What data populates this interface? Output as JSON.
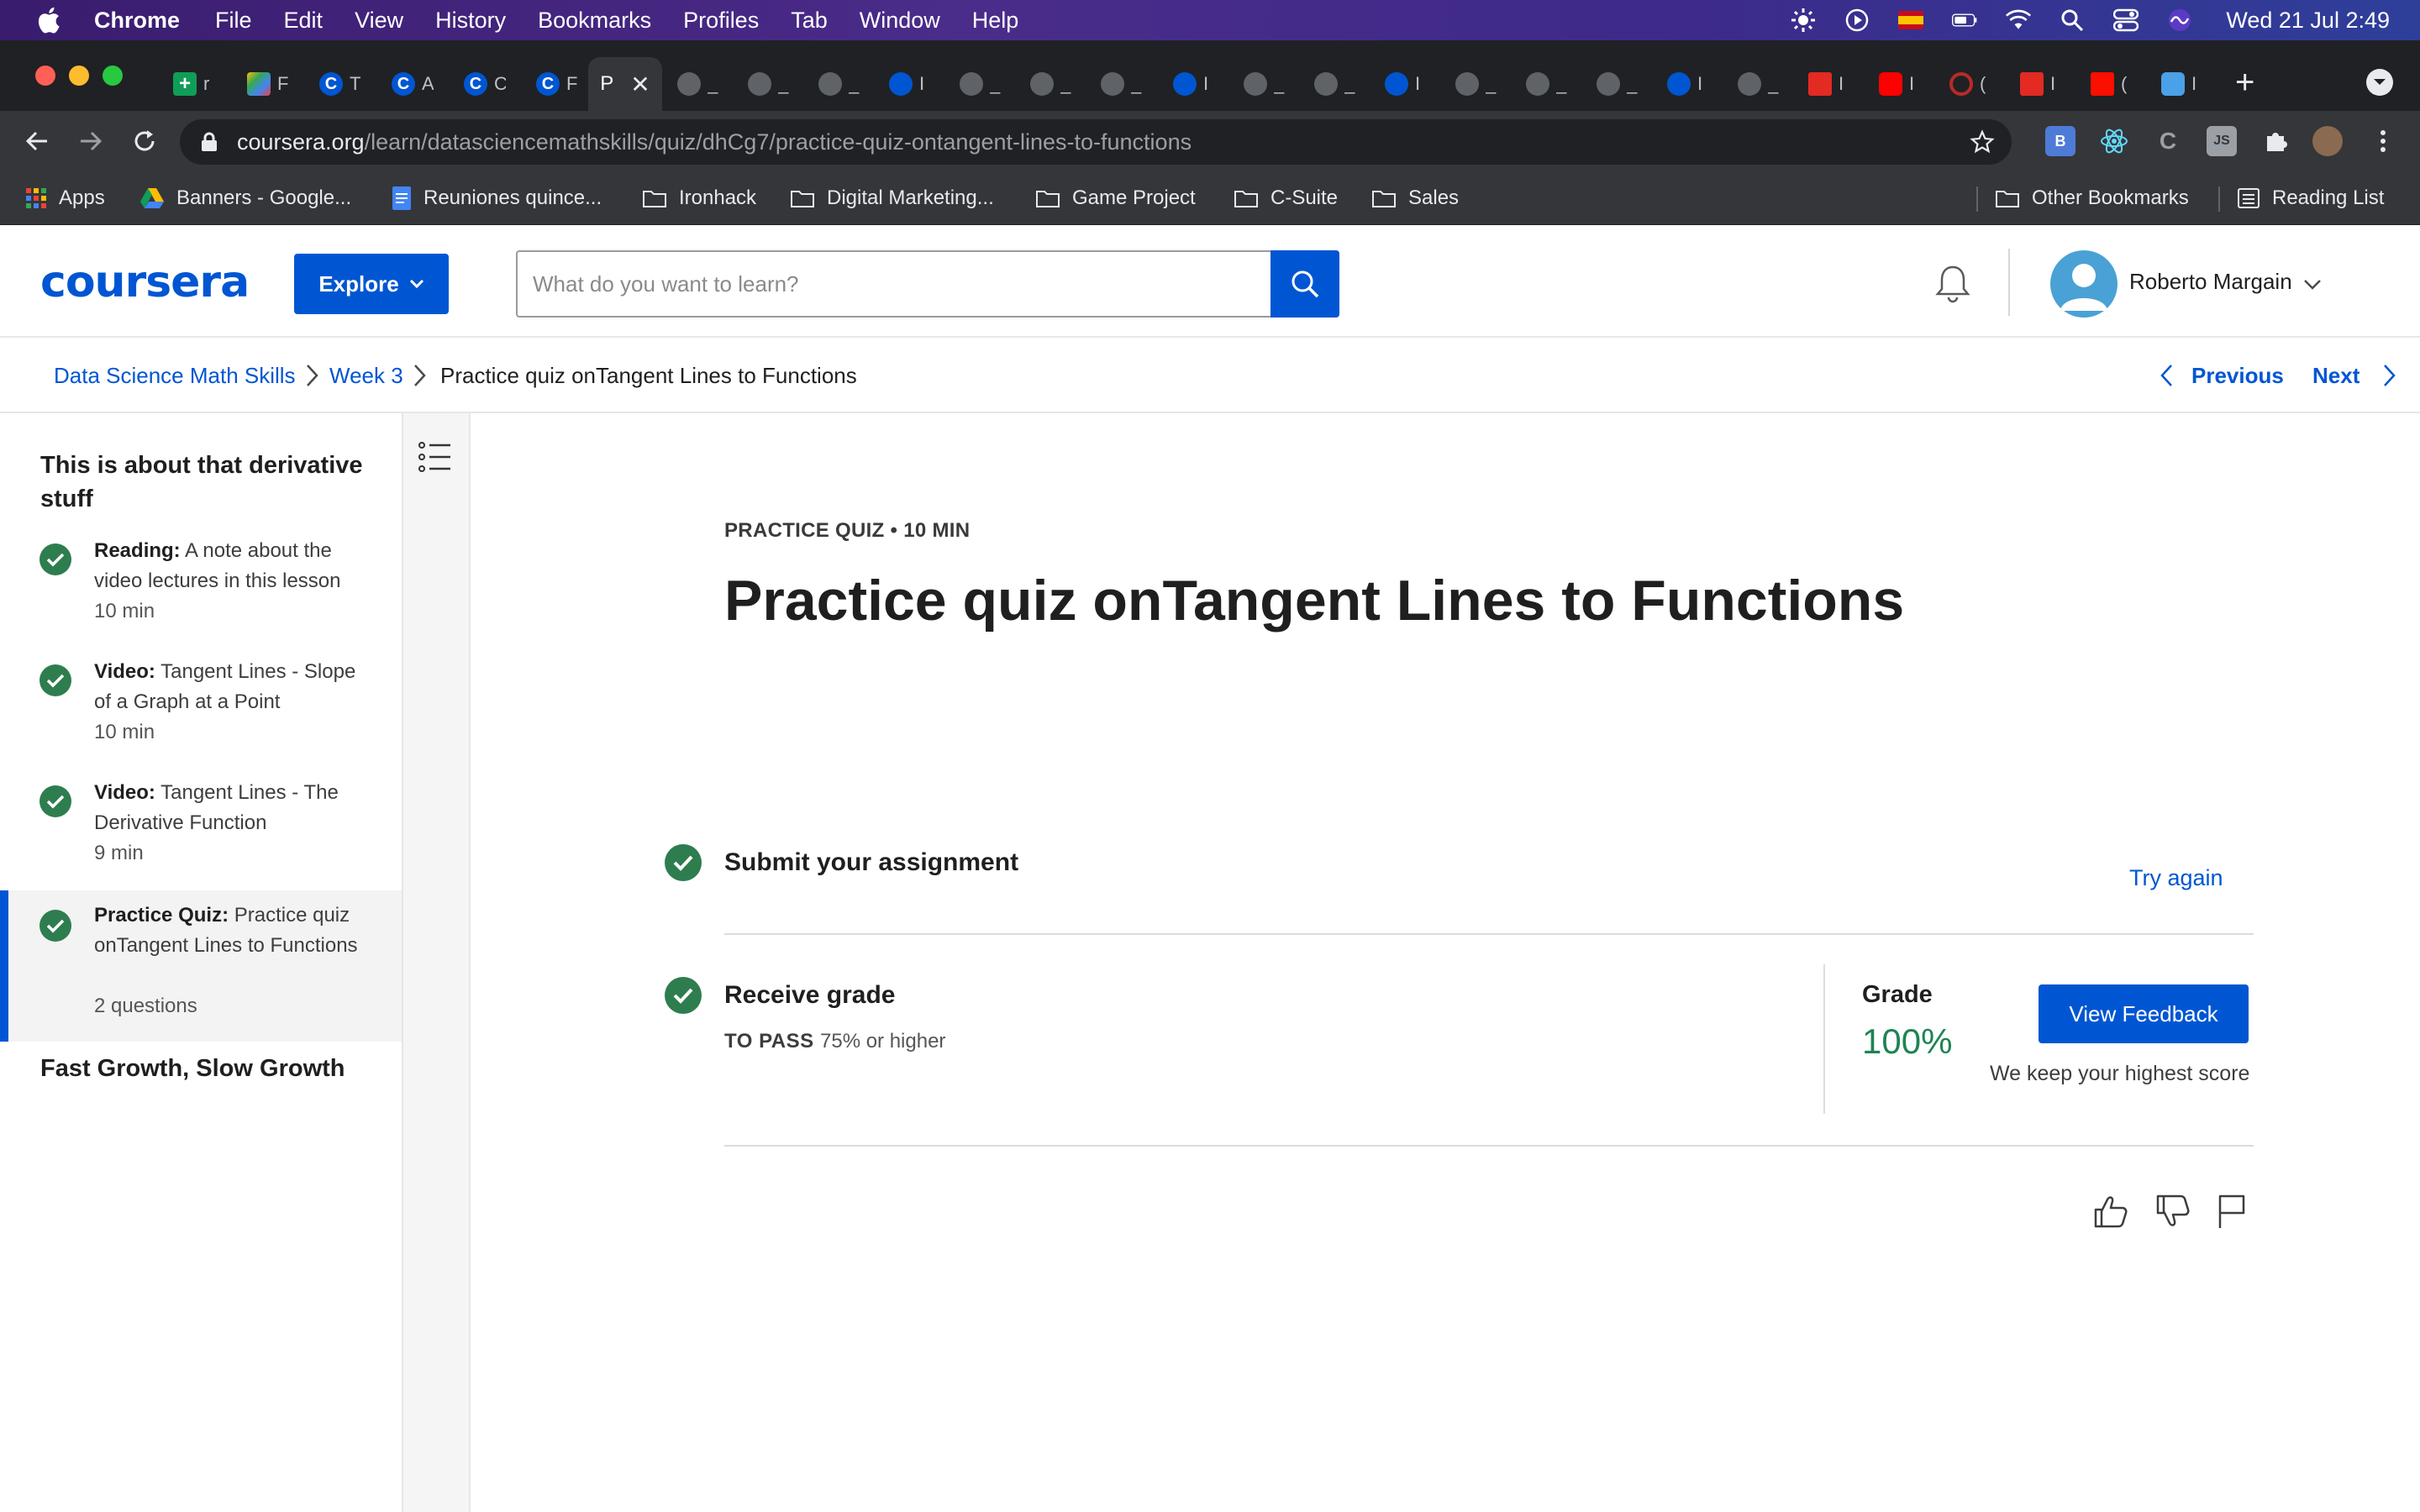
{
  "menubar": {
    "app": "Chrome",
    "items": [
      "File",
      "Edit",
      "View",
      "History",
      "Bookmarks",
      "Profiles",
      "Tab",
      "Window",
      "Help"
    ],
    "clock": "Wed 21 Jul  2:49"
  },
  "tabs": {
    "active_title": "P",
    "favicons": [
      "sheets-icon",
      "colorful-icon",
      "coursera-icon",
      "coursera-icon",
      "coursera-icon",
      "coursera-icon",
      "page-icon",
      "globe-icon",
      "globe-icon",
      "globe-icon",
      "coursera-icon",
      "globe-icon",
      "globe-icon",
      "globe-icon",
      "coursera-icon",
      "globe-icon",
      "globe-icon",
      "coursera-icon",
      "globe-icon",
      "globe-icon",
      "globe-icon",
      "coursera-icon",
      "globe-icon",
      "red-n-icon",
      "youtube-icon",
      "red-q-icon",
      "red-n-icon",
      "adobe-icon",
      "blue-icon"
    ],
    "snippets": [
      "r",
      "F",
      "T",
      "A",
      "C",
      "F",
      "",
      "_",
      "_",
      "_",
      "I",
      "_",
      "_",
      "_",
      "I",
      "_",
      "_",
      "I",
      "_",
      "_",
      "_",
      "I",
      "_",
      "I",
      "I",
      "(",
      "I",
      "(",
      "I"
    ]
  },
  "toolbar": {
    "url_host": "coursera.org",
    "url_path": "/learn/datasciencemathskills/quiz/dhCg7/practice-quiz-ontangent-lines-to-functions"
  },
  "bookmarks": {
    "items": [
      "Apps",
      "Banners - Google...",
      "Reuniones quince...",
      "Ironhack",
      "Digital Marketing...",
      "Game Project",
      "C-Suite",
      "Sales"
    ],
    "right": [
      "Other Bookmarks",
      "Reading List"
    ]
  },
  "header": {
    "logo": "coursera",
    "explore": "Explore",
    "search_placeholder": "What do you want to learn?",
    "user_name": "Roberto Margain"
  },
  "breadcrumb": {
    "items": [
      "Data Science Math Skills",
      "Week 3",
      "Practice quiz onTangent Lines to Functions"
    ],
    "previous": "Previous",
    "next": "Next"
  },
  "sidebar": {
    "module_title": "This is about that derivative stuff",
    "items": [
      {
        "type": "Reading:",
        "title": "A note about the video lectures in this lesson",
        "duration": "10 min"
      },
      {
        "type": "Video:",
        "title": "Tangent Lines - Slope of a Graph at a Point",
        "duration": "10 min"
      },
      {
        "type": "Video:",
        "title": "Tangent Lines - The Derivative Function",
        "duration": "9 min"
      },
      {
        "type": "Practice Quiz:",
        "title": "Practice quiz onTangent Lines to Functions",
        "duration": "2 questions"
      }
    ],
    "next_module": "Fast Growth, Slow Growth"
  },
  "main": {
    "kicker": "PRACTICE QUIZ • 10 MIN",
    "title": "Practice quiz onTangent Lines to Functions",
    "submit_title": "Submit your assignment",
    "try_again": "Try again",
    "receive_title": "Receive grade",
    "to_pass_label": "TO PASS",
    "to_pass_value": "75% or higher",
    "grade_label": "Grade",
    "grade_value": "100%",
    "view_feedback": "View Feedback",
    "keep_note": "We keep your highest score"
  },
  "colors": {
    "brand": "#0056d2",
    "success": "#1f8354",
    "check": "#2e7d4f"
  }
}
